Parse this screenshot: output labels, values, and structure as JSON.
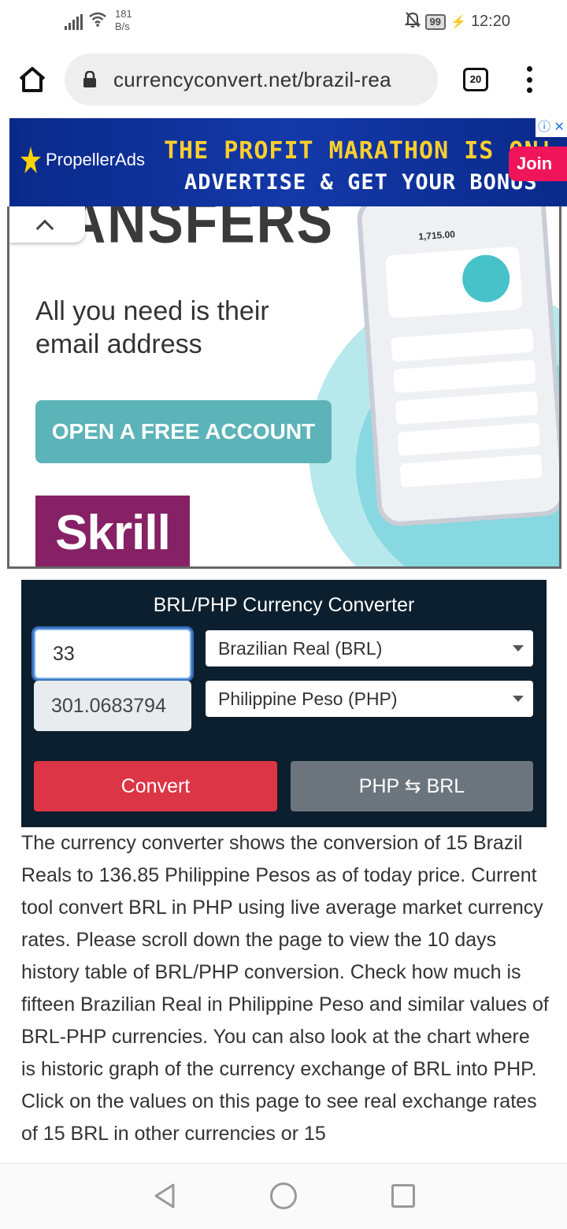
{
  "status_bar": {
    "net_speed_value": "181",
    "net_speed_unit": "B/s",
    "battery": "99",
    "time": "12:20"
  },
  "browser": {
    "url": "currencyconvert.net/brazil-rea",
    "tab_count": "20"
  },
  "ad_banner": {
    "brand": "PropellerAds",
    "headline": "THE PROFIT MARATHON IS ON!",
    "subline": "ADVERTISE & GET YOUR BONUS",
    "cta": "Join",
    "info_symbol": "ⓘ ✕"
  },
  "skrill_ad": {
    "heading_fragment": "RANSFERS",
    "subtitle": "All you need is their email address",
    "cta": "OPEN A FREE ACCOUNT",
    "logo": "Skrill",
    "phone_amount": "1,715.00"
  },
  "converter": {
    "title": "BRL/PHP Currency Converter",
    "amount_value": "33",
    "result_value": "301.0683794",
    "from_currency": "Brazilian Real (BRL)",
    "to_currency": "Philippine Peso (PHP)",
    "convert_label": "Convert",
    "swap_label": "PHP ⇆ BRL"
  },
  "description": {
    "text": "The currency converter shows the conversion of 15 Brazil Reals to 136.85 Philippine Pesos as of today price. Current tool convert BRL in PHP using live average market currency rates. Please scroll down the page to view the 10 days history table of BRL/PHP conversion. Check how much is fifteen Brazilian Real in Philippine Peso and similar values of BRL-PHP currencies. You can also look at the chart where is historic graph of the currency exchange of BRL into PHP. Click on the values on this page to see real exchange rates of 15 BRL in other currencies or 15"
  }
}
